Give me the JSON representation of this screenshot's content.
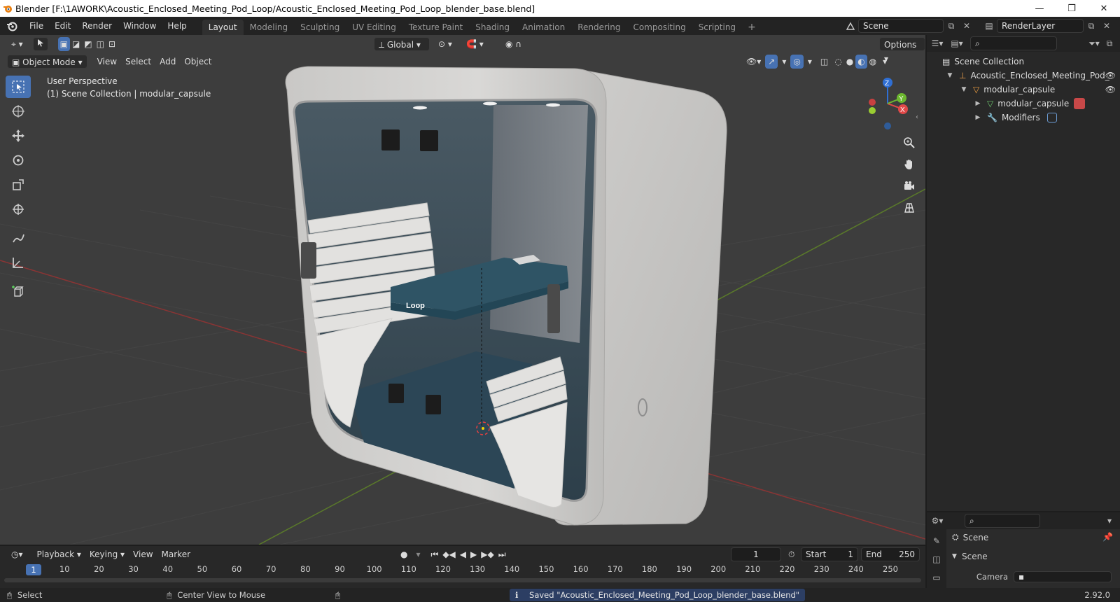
{
  "window": {
    "title": "Blender [F:\\1AWORK\\Acoustic_Enclosed_Meeting_Pod_Loop/Acoustic_Enclosed_Meeting_Pod_Loop_blender_base.blend]",
    "minimize": "—",
    "maximize": "❐",
    "close": "✕"
  },
  "menu": [
    "File",
    "Edit",
    "Render",
    "Window",
    "Help"
  ],
  "workspaces": [
    "Layout",
    "Modeling",
    "Sculpting",
    "UV Editing",
    "Texture Paint",
    "Shading",
    "Animation",
    "Rendering",
    "Compositing",
    "Scripting"
  ],
  "active_workspace": "Layout",
  "scene_selector": "Scene",
  "render_layer": "RenderLayer",
  "viewport": {
    "transform_orientation": "Global",
    "options_label": "Options",
    "mode": "Object Mode",
    "menus": [
      "View",
      "Select",
      "Add",
      "Object"
    ],
    "perspective_label": "User Perspective",
    "collection_info": "(1) Scene Collection | modular_capsule",
    "gizmo_axes": {
      "x": "X",
      "y": "Y",
      "z": "Z"
    }
  },
  "outliner": {
    "root": "Scene Collection",
    "items": [
      {
        "label": "Acoustic_Enclosed_Meeting_Pod_",
        "depth": 1
      },
      {
        "label": "modular_capsule",
        "depth": 2
      },
      {
        "label": "modular_capsule",
        "depth": 3
      },
      {
        "label": "Modifiers",
        "depth": 3
      }
    ]
  },
  "properties": {
    "scene_title": "Scene",
    "section": "Scene",
    "camera_label": "Camera"
  },
  "timeline": {
    "menus": [
      "Playback",
      "Keying",
      "View",
      "Marker"
    ],
    "current_frame": "1",
    "start_label": "Start",
    "start_value": "1",
    "end_label": "End",
    "end_value": "250",
    "ticks": [
      "1",
      "10",
      "20",
      "30",
      "40",
      "50",
      "60",
      "70",
      "80",
      "90",
      "100",
      "110",
      "120",
      "130",
      "140",
      "150",
      "160",
      "170",
      "180",
      "190",
      "200",
      "210",
      "220",
      "230",
      "240",
      "250"
    ]
  },
  "statusbar": {
    "select": "Select",
    "center_view": "Center View to Mouse",
    "saved_message": "Saved \"Acoustic_Enclosed_Meeting_Pod_Loop_blender_base.blend\"",
    "version": "2.92.0"
  },
  "model_logo": "Loop",
  "colors": {
    "accent": "#4772b3",
    "bg": "#3d3d3d",
    "panel": "#282828"
  }
}
